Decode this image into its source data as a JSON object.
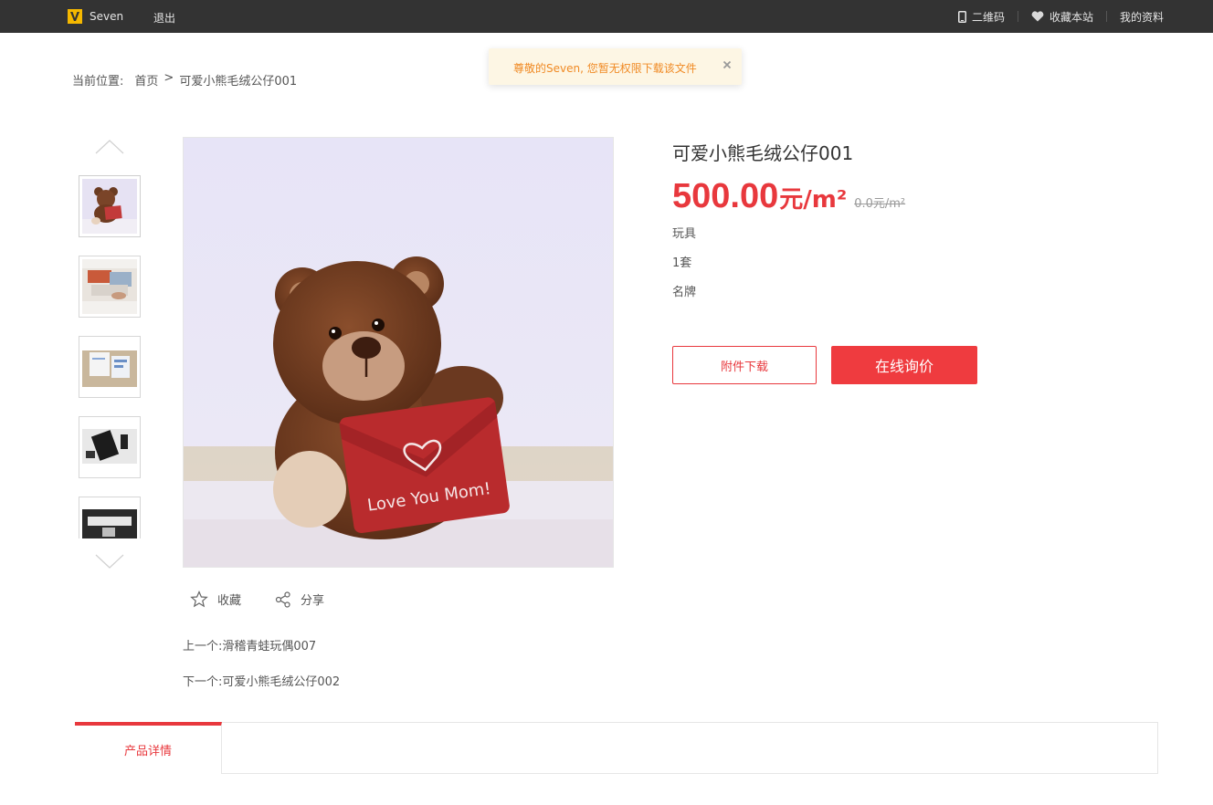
{
  "topbar": {
    "username": "Seven",
    "logout": "退出",
    "qrcode": "二维码",
    "favorite_site": "收藏本站",
    "my_profile": "我的资料",
    "icons": [
      "logo-icon",
      "phone-icon",
      "heart-icon"
    ],
    "logo_color": "#f5b800"
  },
  "toast": {
    "message": "尊敬的Seven, 您暂无权限下载该文件",
    "close": "×"
  },
  "breadcrumb": {
    "label": "当前位置:",
    "home": "首页",
    "separator": ">",
    "current": "可爱小熊毛绒公仔001"
  },
  "gallery": {
    "thumbnails": [
      "teddy-bear",
      "laptop-desk",
      "documents-desk",
      "tablet-phone",
      "workspace"
    ],
    "main_image_text": "Love You Mom!"
  },
  "actions": {
    "favorite": "收藏",
    "share": "分享"
  },
  "navigation": {
    "prev_label": "上一个:",
    "prev_title": "滑稽青蛙玩偶007",
    "next_label": "下一个:",
    "next_title": "可爱小熊毛绒公仔002"
  },
  "product": {
    "title": "可爱小熊毛绒公仔001",
    "price": "500.00",
    "price_unit": "元/m²",
    "old_price": "0.0元/m²",
    "category": "玩具",
    "quantity": "1套",
    "brand": "名牌",
    "download_button": "附件下载",
    "inquiry_button": "在线询价",
    "accent_color": "#e8383d"
  },
  "tabs": {
    "details": "产品详情"
  }
}
